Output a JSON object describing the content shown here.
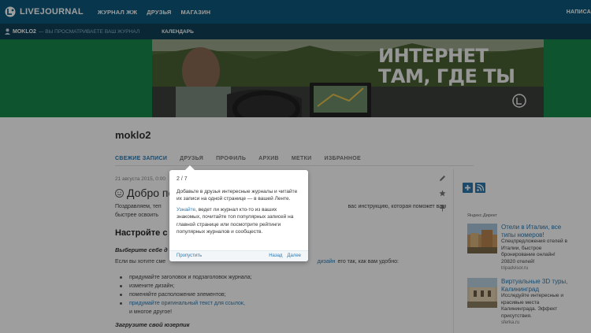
{
  "topbar": {
    "logo_text": "LIVEJOURNAL",
    "nav": [
      "ЖУРНАЛ ЖЖ",
      "ДРУЗЬЯ",
      "МАГАЗИН"
    ],
    "right_link": "НАПИСА"
  },
  "subbar": {
    "username": "MOKLO2",
    "note": "— ВЫ ПРОСМАТРИВАЕТЕ ВАШ ЖУРНАЛ",
    "calendar": "КАЛЕНДАРЬ"
  },
  "banner": {
    "line1": "ИНТЕРНЕТ",
    "line2": "ТАМ, ГДЕ ТЫ",
    "bg_color": "#178a4c"
  },
  "journal": {
    "name": "moklo2",
    "tabs": [
      "СВЕЖИЕ ЗАПИСИ",
      "ДРУЗЬЯ",
      "ПРОФИЛЬ",
      "АРХИВ",
      "МЕТКИ",
      "ИЗБРАННОЕ"
    ],
    "active_tab": 0
  },
  "post": {
    "date": "21 августа 2015, 0:00",
    "title": "Добро пож",
    "intro_line1": "Поздравляем, теп",
    "intro_line1_end": "вас инструкцию, которая поможет вам",
    "intro_line2": "быстрее освоить",
    "setup_heading": "Настройте с",
    "choose_heading": "Выберите себе д",
    "choose_text_start": "Если вы хотите сме",
    "choose_text_link": "дизайн",
    "choose_text_end": "его так, как вам удобно:",
    "list_items": [
      "придумайте заголовок и подзаголовок журнала;",
      "измените дизайн;",
      "поменяйте расположение элементов;",
      "придумайте оригинальный текст для ссылок,",
      "и многое другое!"
    ],
    "userpic_heading": "Загрузите свой юзерпик"
  },
  "popup": {
    "counter": "2 / 7",
    "text1": "Добавьте в друзья интересные журналы и читайте их записи на одной странице — в вашей Ленте.",
    "text2_link": "Узнайте",
    "text2": ", ведет ли журнал кто-то из ваших знакомых, почитайте топ популярных записей на главной странице или посмотрите рейтинги популярных журналов и сообществ.",
    "skip": "Пропустить",
    "back": "Назад",
    "next": "Далее"
  },
  "ads": {
    "label": "Яндекс.Директ",
    "items": [
      {
        "title": "Отели в Италии, все типы номеров!",
        "desc": "Спецпредложения отелей в Италии, быстрое бронирование онлайн! 20820 отелей!",
        "domain": "tripadvisor.ru"
      },
      {
        "title": "Виртуальные 3D туры, Калининград",
        "desc": "Исследуйте интересные и красивые места Калининграда. Эффект присутствия.",
        "domain": "sferka.ru"
      }
    ]
  },
  "colors": {
    "topbar": "#0e5a7d",
    "subbar": "#0f3f56",
    "link": "#2a7ab0"
  }
}
